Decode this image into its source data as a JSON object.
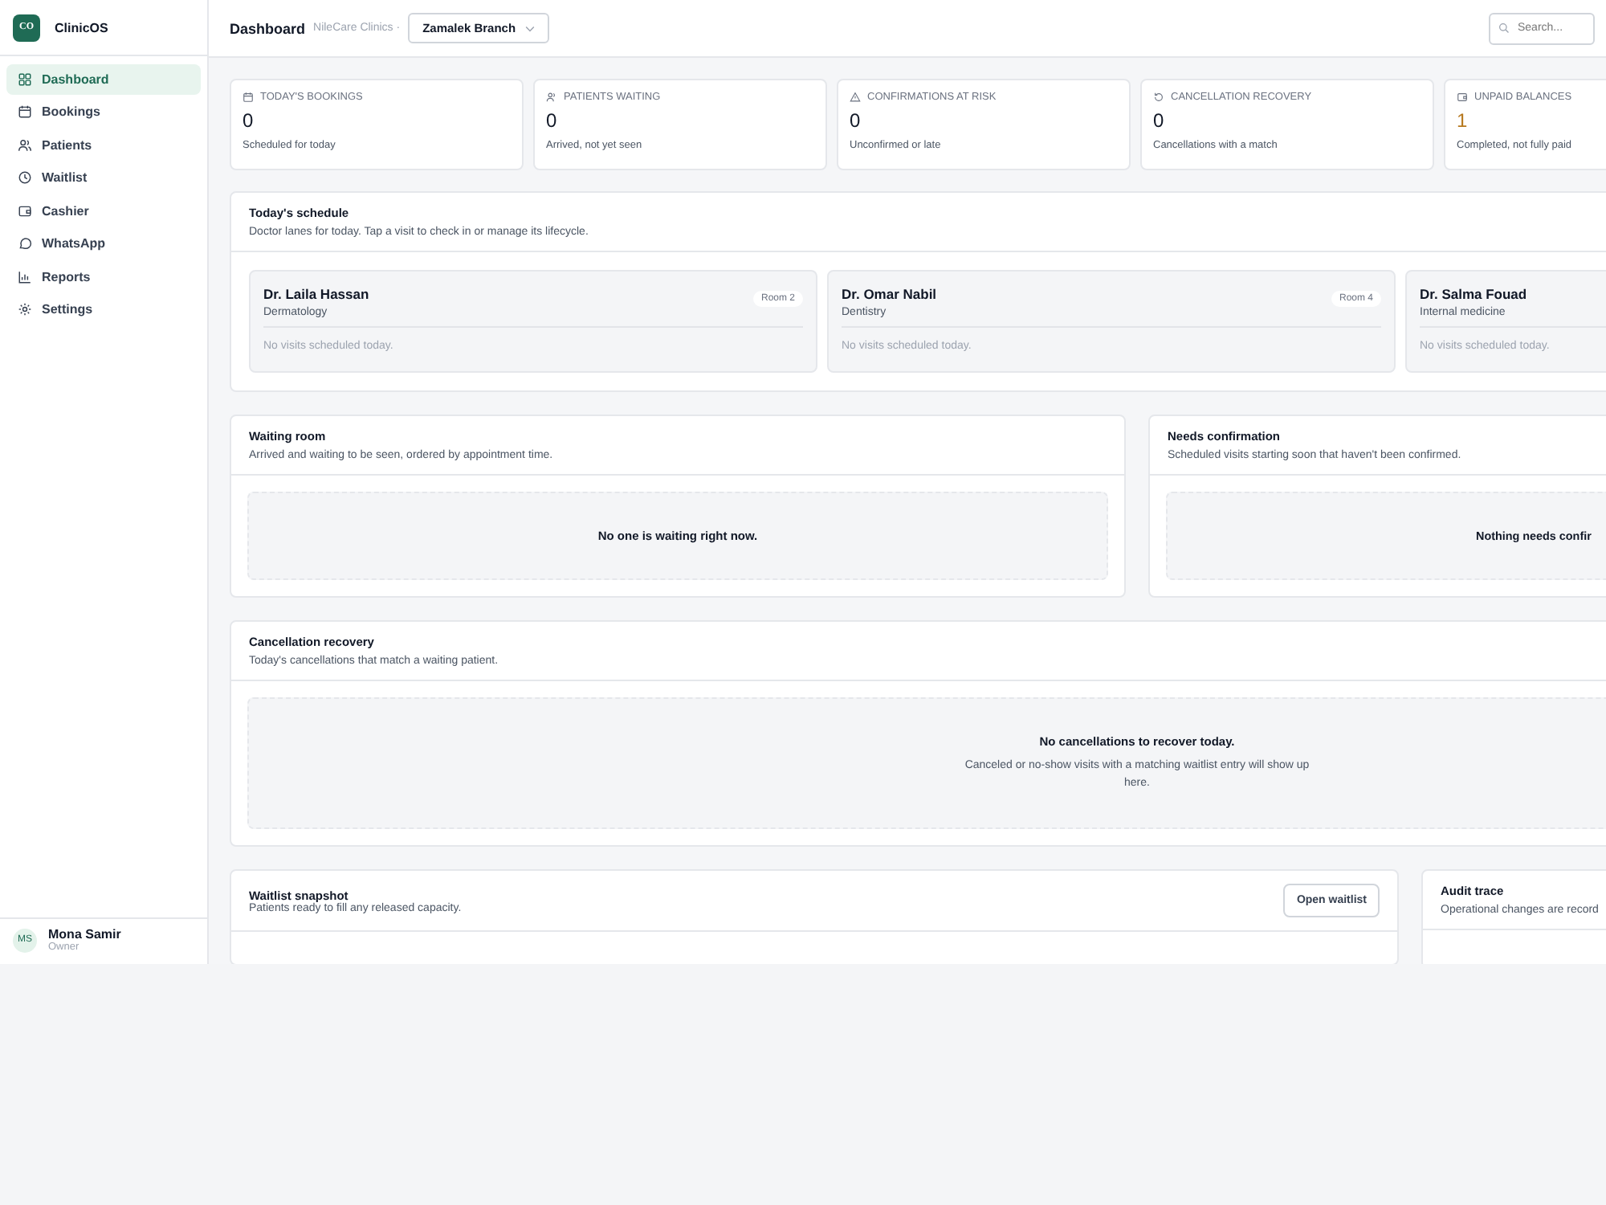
{
  "sidebar": {
    "logo_badge": "CO",
    "app_name": "ClinicOS",
    "items": [
      {
        "label": "Dashboard",
        "kind": "grid",
        "selected": true
      },
      {
        "label": "Bookings",
        "kind": "calendar",
        "selected": false
      },
      {
        "label": "Patients",
        "kind": "users",
        "selected": false
      },
      {
        "label": "Waitlist",
        "kind": "clock",
        "selected": false
      },
      {
        "label": "Cashier",
        "kind": "wallet",
        "selected": false
      },
      {
        "label": "WhatsApp",
        "kind": "chat",
        "selected": false
      },
      {
        "label": "Reports",
        "kind": "chart",
        "selected": false
      },
      {
        "label": "Settings",
        "kind": "gear",
        "selected": false
      }
    ],
    "user": {
      "initials": "MS",
      "name": "Mona Samir",
      "role": "Owner"
    }
  },
  "topbar": {
    "title": "Dashboard",
    "org": "NileCare Clinics ·",
    "branch": "Zamalek Branch",
    "search": {
      "placeholder": "Search..."
    }
  },
  "stats": [
    {
      "kind": "calendar",
      "label": "TODAY'S BOOKINGS",
      "value": "0",
      "caption": "Scheduled for today",
      "highlight": false
    },
    {
      "kind": "users",
      "label": "PATIENTS WAITING",
      "value": "0",
      "caption": "Arrived, not yet seen",
      "highlight": false
    },
    {
      "kind": "warning",
      "label": "CONFIRMATIONS AT RISK",
      "value": "0",
      "caption": "Unconfirmed or late",
      "highlight": false
    },
    {
      "kind": "rotate",
      "label": "CANCELLATION RECOVERY",
      "value": "0",
      "caption": "Cancellations with a match",
      "highlight": false
    },
    {
      "kind": "wallet",
      "label": "UNPAID BALANCES",
      "value": "1",
      "caption": "Completed, not fully paid",
      "highlight": true
    }
  ],
  "schedule": {
    "title": "Today's schedule",
    "subtitle": "Doctor lanes for today. Tap a visit to check in or manage its lifecycle.",
    "lanes": [
      {
        "doctor": "Dr. Laila Hassan",
        "specialty": "Dermatology",
        "room": "Room 2",
        "empty": "No visits scheduled today."
      },
      {
        "doctor": "Dr. Omar Nabil",
        "specialty": "Dentistry",
        "room": "Room 4",
        "empty": "No visits scheduled today."
      },
      {
        "doctor": "Dr. Salma Fouad",
        "specialty": "Internal medicine",
        "empty": "No visits scheduled today."
      }
    ]
  },
  "waiting_room": {
    "title": "Waiting room",
    "subtitle": "Arrived and waiting to be seen, ordered by appointment time.",
    "empty": "No one is waiting right now."
  },
  "needs_confirmation": {
    "title": "Needs confirmation",
    "subtitle": "Scheduled visits starting soon that haven't been confirmed.",
    "empty": "Nothing needs confir"
  },
  "cancellation_recovery": {
    "title": "Cancellation recovery",
    "subtitle": "Today's cancellations that match a waiting patient.",
    "empty_title": "No cancellations to recover today.",
    "empty_text": "Canceled or no-show visits with a matching waitlist entry will show up here."
  },
  "waitlist_snapshot": {
    "title": "Waitlist snapshot",
    "subtitle": "Patients ready to fill any released capacity.",
    "button": "Open waitlist"
  },
  "audit_trace": {
    "title": "Audit trace",
    "subtitle": "Operational changes are record"
  }
}
